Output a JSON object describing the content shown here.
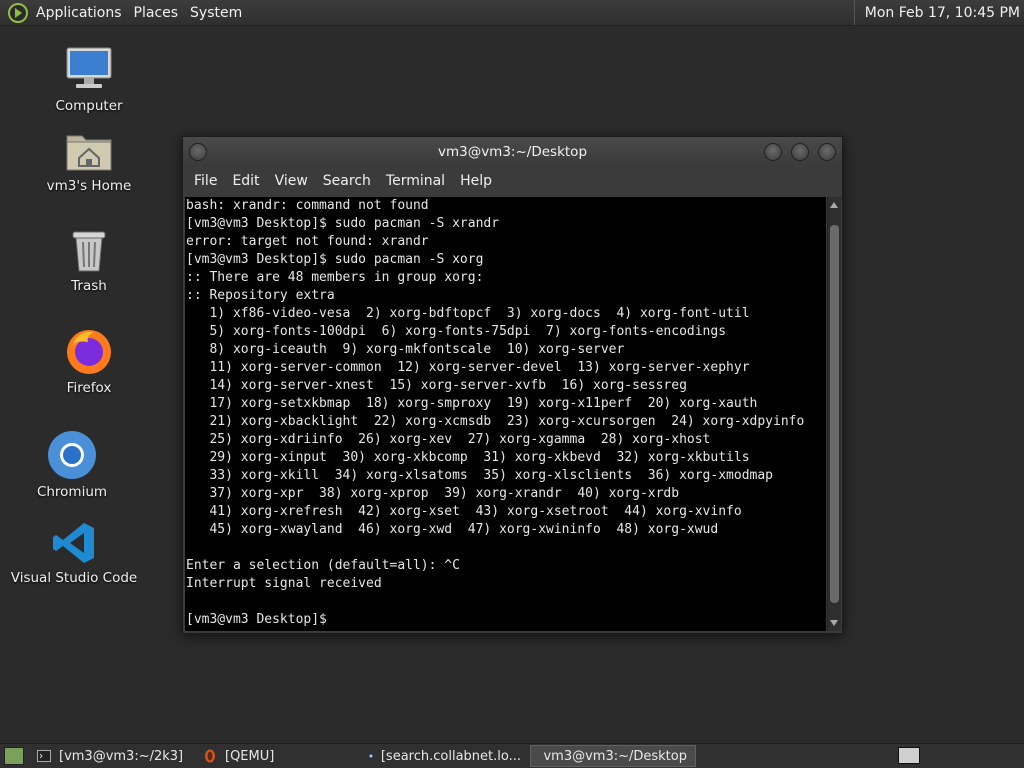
{
  "top_panel": {
    "menus": [
      "Applications",
      "Places",
      "System"
    ],
    "clock": "Mon Feb 17, 10:45 PM"
  },
  "desktop_icons": [
    {
      "name": "computer",
      "label": "Computer"
    },
    {
      "name": "home",
      "label": "vm3's Home"
    },
    {
      "name": "trash",
      "label": "Trash"
    },
    {
      "name": "firefox",
      "label": "Firefox"
    },
    {
      "name": "chromium",
      "label": "Chromium"
    },
    {
      "name": "vscode",
      "label": "Visual Studio Code"
    }
  ],
  "window": {
    "title": "vm3@vm3:~/Desktop",
    "menu": [
      "File",
      "Edit",
      "View",
      "Search",
      "Terminal",
      "Help"
    ]
  },
  "terminal_lines": [
    "bash: xrandr: command not found",
    "[vm3@vm3 Desktop]$ sudo pacman -S xrandr",
    "error: target not found: xrandr",
    "[vm3@vm3 Desktop]$ sudo pacman -S xorg",
    ":: There are 48 members in group xorg:",
    ":: Repository extra",
    "   1) xf86-video-vesa  2) xorg-bdftopcf  3) xorg-docs  4) xorg-font-util",
    "   5) xorg-fonts-100dpi  6) xorg-fonts-75dpi  7) xorg-fonts-encodings",
    "   8) xorg-iceauth  9) xorg-mkfontscale  10) xorg-server",
    "   11) xorg-server-common  12) xorg-server-devel  13) xorg-server-xephyr",
    "   14) xorg-server-xnest  15) xorg-server-xvfb  16) xorg-sessreg",
    "   17) xorg-setxkbmap  18) xorg-smproxy  19) xorg-x11perf  20) xorg-xauth",
    "   21) xorg-xbacklight  22) xorg-xcmsdb  23) xorg-xcursorgen  24) xorg-xdpyinfo",
    "   25) xorg-xdriinfo  26) xorg-xev  27) xorg-xgamma  28) xorg-xhost",
    "   29) xorg-xinput  30) xorg-xkbcomp  31) xorg-xkbevd  32) xorg-xkbutils",
    "   33) xorg-xkill  34) xorg-xlsatoms  35) xorg-xlsclients  36) xorg-xmodmap",
    "   37) xorg-xpr  38) xorg-xprop  39) xorg-xrandr  40) xorg-xrdb",
    "   41) xorg-xrefresh  42) xorg-xset  43) xorg-xsetroot  44) xorg-xvinfo",
    "   45) xorg-xwayland  46) xorg-xwd  47) xorg-xwininfo  48) xorg-xwud",
    "",
    "Enter a selection (default=all): ^C",
    "Interrupt signal received",
    "",
    "[vm3@vm3 Desktop]$ "
  ],
  "taskbar": {
    "tasks": [
      {
        "label": "[vm3@vm3:~/2k3]",
        "icon": "terminal-icon",
        "active": false
      },
      {
        "label": "[QEMU]",
        "icon": "qemu-icon",
        "active": false
      },
      {
        "label": "[search.collabnet.lo...",
        "icon": "chromium-icon",
        "active": false
      },
      {
        "label": "vm3@vm3:~/Desktop",
        "icon": "terminal-icon",
        "active": true
      }
    ]
  },
  "colors": {
    "desktop_bg": "#2b2b2b",
    "panel_bg": "#303030",
    "terminal_bg": "#000000",
    "terminal_fg": "#e6e6e6"
  }
}
